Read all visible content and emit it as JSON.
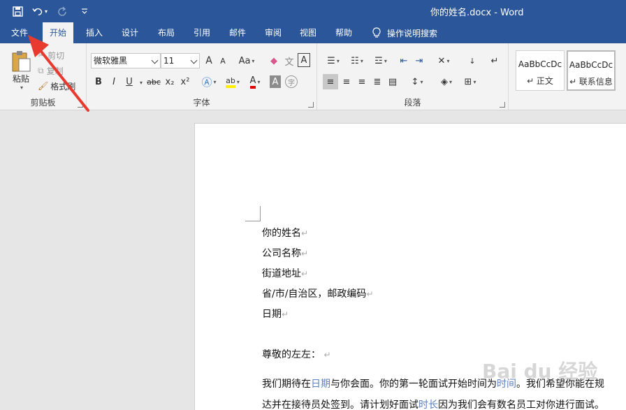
{
  "titlebar": {
    "doc_title": "你的姓名.docx  -  Word",
    "qat": {
      "save": "save-icon",
      "undo": "undo-icon",
      "redo": "redo-icon",
      "customize": "chevron-down-icon"
    }
  },
  "tabs": [
    "文件",
    "开始",
    "插入",
    "设计",
    "布局",
    "引用",
    "邮件",
    "审阅",
    "视图",
    "帮助"
  ],
  "tell_me": "操作说明搜索",
  "ribbon": {
    "clipboard": {
      "paste": "粘贴",
      "cut": "剪切",
      "copy": "复制",
      "format_painter": "格式刷",
      "label": "剪贴板"
    },
    "font": {
      "family": "微软雅黑",
      "size": "11",
      "label": "字体",
      "bold": "B",
      "italic": "I",
      "underline": "U",
      "strike": "abc",
      "sub": "x₂",
      "sup": "x²",
      "grow": "A",
      "shrink": "A",
      "case": "Aa",
      "char_border": "A",
      "char_shade": "A",
      "color": "A",
      "enclose": "字",
      "phonetic": "文"
    },
    "paragraph": {
      "label": "段落"
    },
    "styles": [
      {
        "sample": "AaBbCcDc",
        "name": "↵ 正文"
      },
      {
        "sample": "AaBbCcDc",
        "name": "↵ 联系信息"
      }
    ]
  },
  "document": {
    "lines": [
      "你的姓名",
      "公司名称",
      "街道地址",
      "省/市/自治区，邮政编码",
      "日期"
    ],
    "salutation": "尊敬的左左：",
    "body_line1": {
      "a": "我们期待在",
      "b": "日期",
      "c": "与你会面。你的第一轮面试开始时间为",
      "d": "时间",
      "e": "。我们希望你能在规"
    },
    "body_line2": {
      "a": "达并在接待员处签到。请计划好面试",
      "b": "时长",
      "c": "因为我们会有数名员工对你进行面试。"
    },
    "para_mark": "↵"
  },
  "watermark": "Bai du 经验",
  "colors": {
    "brand": "#2b579a",
    "arrow": "#e83a2f"
  }
}
